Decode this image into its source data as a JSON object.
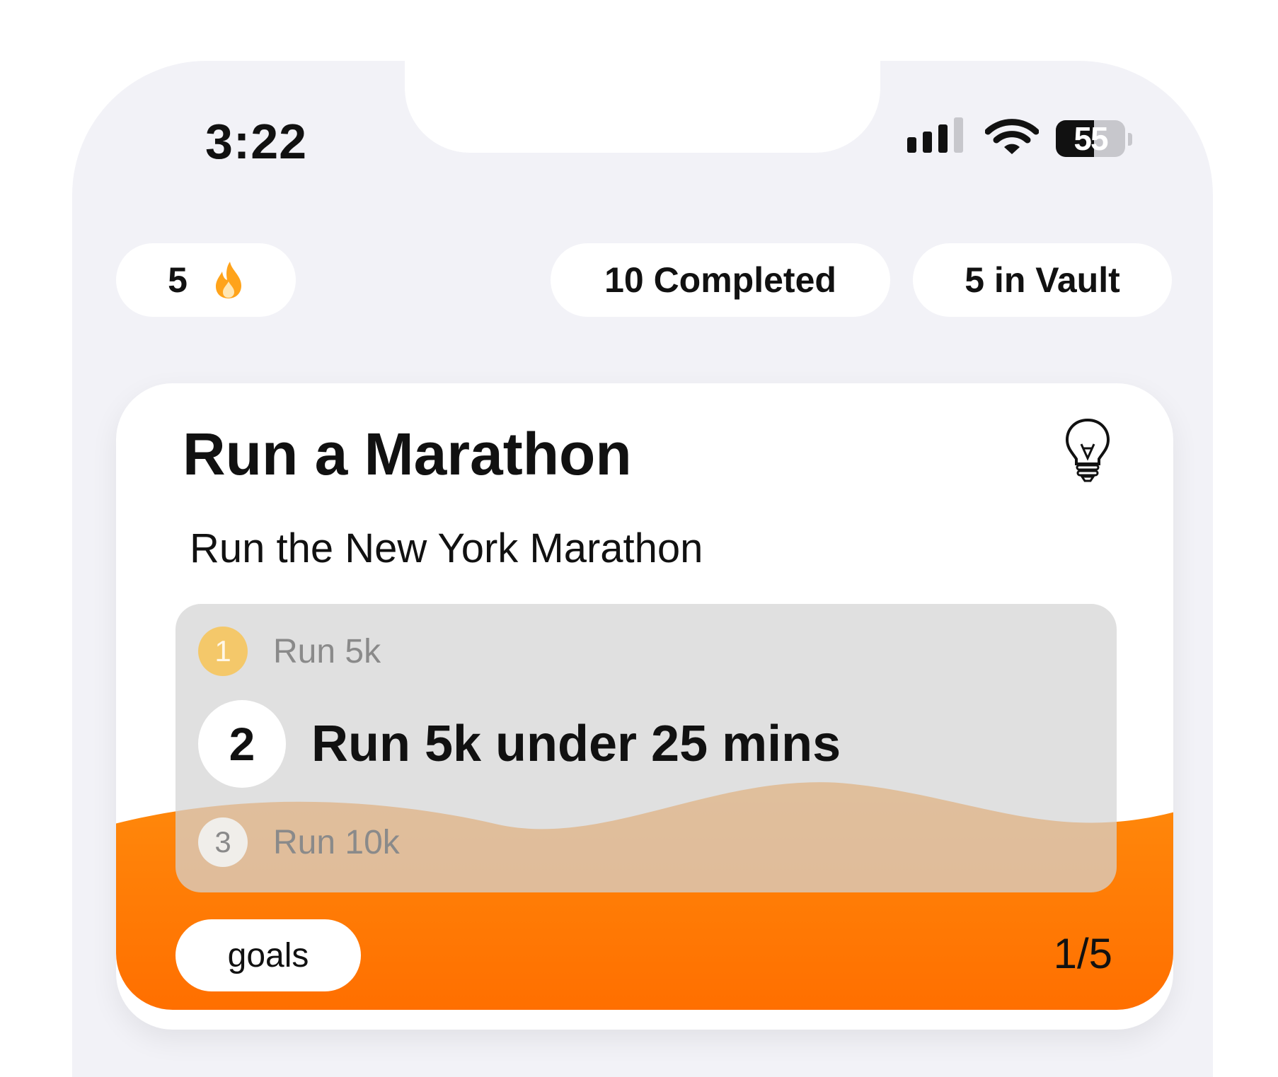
{
  "status_bar": {
    "time": "3:22",
    "battery_level": "55",
    "battery_fraction": 0.55,
    "icons": [
      "cellular-signal-icon",
      "wifi-icon",
      "battery-icon"
    ]
  },
  "stats": {
    "streak_count": "5",
    "streak_icon": "flame-icon",
    "completed_label": "10 Completed",
    "vault_label": "5 in Vault"
  },
  "goal_card": {
    "title": "Run a Marathon",
    "description": "Run the New York Marathon",
    "hint_icon": "lightbulb-icon",
    "steps": [
      {
        "number": "1",
        "label": "Run 5k"
      },
      {
        "number": "2",
        "label": "Run 5k under 25 mins"
      },
      {
        "number": "3",
        "label": "Run 10k"
      }
    ],
    "tag": "goals",
    "progress": "1/5",
    "progress_fraction": 0.2
  },
  "colors": {
    "accent_orange": "#ff7a00",
    "step_done": "#f4c86a",
    "background": "#f2f2f7"
  }
}
